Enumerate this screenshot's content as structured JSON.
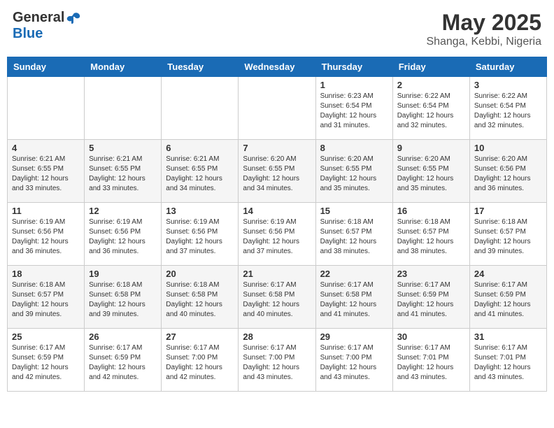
{
  "header": {
    "logo_general": "General",
    "logo_blue": "Blue",
    "title": "May 2025",
    "subtitle": "Shanga, Kebbi, Nigeria"
  },
  "days_of_week": [
    "Sunday",
    "Monday",
    "Tuesday",
    "Wednesday",
    "Thursday",
    "Friday",
    "Saturday"
  ],
  "weeks": [
    [
      {
        "day": "",
        "info": ""
      },
      {
        "day": "",
        "info": ""
      },
      {
        "day": "",
        "info": ""
      },
      {
        "day": "",
        "info": ""
      },
      {
        "day": "1",
        "info": "Sunrise: 6:23 AM\nSunset: 6:54 PM\nDaylight: 12 hours\nand 31 minutes."
      },
      {
        "day": "2",
        "info": "Sunrise: 6:22 AM\nSunset: 6:54 PM\nDaylight: 12 hours\nand 32 minutes."
      },
      {
        "day": "3",
        "info": "Sunrise: 6:22 AM\nSunset: 6:54 PM\nDaylight: 12 hours\nand 32 minutes."
      }
    ],
    [
      {
        "day": "4",
        "info": "Sunrise: 6:21 AM\nSunset: 6:55 PM\nDaylight: 12 hours\nand 33 minutes."
      },
      {
        "day": "5",
        "info": "Sunrise: 6:21 AM\nSunset: 6:55 PM\nDaylight: 12 hours\nand 33 minutes."
      },
      {
        "day": "6",
        "info": "Sunrise: 6:21 AM\nSunset: 6:55 PM\nDaylight: 12 hours\nand 34 minutes."
      },
      {
        "day": "7",
        "info": "Sunrise: 6:20 AM\nSunset: 6:55 PM\nDaylight: 12 hours\nand 34 minutes."
      },
      {
        "day": "8",
        "info": "Sunrise: 6:20 AM\nSunset: 6:55 PM\nDaylight: 12 hours\nand 35 minutes."
      },
      {
        "day": "9",
        "info": "Sunrise: 6:20 AM\nSunset: 6:55 PM\nDaylight: 12 hours\nand 35 minutes."
      },
      {
        "day": "10",
        "info": "Sunrise: 6:20 AM\nSunset: 6:56 PM\nDaylight: 12 hours\nand 36 minutes."
      }
    ],
    [
      {
        "day": "11",
        "info": "Sunrise: 6:19 AM\nSunset: 6:56 PM\nDaylight: 12 hours\nand 36 minutes."
      },
      {
        "day": "12",
        "info": "Sunrise: 6:19 AM\nSunset: 6:56 PM\nDaylight: 12 hours\nand 36 minutes."
      },
      {
        "day": "13",
        "info": "Sunrise: 6:19 AM\nSunset: 6:56 PM\nDaylight: 12 hours\nand 37 minutes."
      },
      {
        "day": "14",
        "info": "Sunrise: 6:19 AM\nSunset: 6:56 PM\nDaylight: 12 hours\nand 37 minutes."
      },
      {
        "day": "15",
        "info": "Sunrise: 6:18 AM\nSunset: 6:57 PM\nDaylight: 12 hours\nand 38 minutes."
      },
      {
        "day": "16",
        "info": "Sunrise: 6:18 AM\nSunset: 6:57 PM\nDaylight: 12 hours\nand 38 minutes."
      },
      {
        "day": "17",
        "info": "Sunrise: 6:18 AM\nSunset: 6:57 PM\nDaylight: 12 hours\nand 39 minutes."
      }
    ],
    [
      {
        "day": "18",
        "info": "Sunrise: 6:18 AM\nSunset: 6:57 PM\nDaylight: 12 hours\nand 39 minutes."
      },
      {
        "day": "19",
        "info": "Sunrise: 6:18 AM\nSunset: 6:58 PM\nDaylight: 12 hours\nand 39 minutes."
      },
      {
        "day": "20",
        "info": "Sunrise: 6:18 AM\nSunset: 6:58 PM\nDaylight: 12 hours\nand 40 minutes."
      },
      {
        "day": "21",
        "info": "Sunrise: 6:17 AM\nSunset: 6:58 PM\nDaylight: 12 hours\nand 40 minutes."
      },
      {
        "day": "22",
        "info": "Sunrise: 6:17 AM\nSunset: 6:58 PM\nDaylight: 12 hours\nand 41 minutes."
      },
      {
        "day": "23",
        "info": "Sunrise: 6:17 AM\nSunset: 6:59 PM\nDaylight: 12 hours\nand 41 minutes."
      },
      {
        "day": "24",
        "info": "Sunrise: 6:17 AM\nSunset: 6:59 PM\nDaylight: 12 hours\nand 41 minutes."
      }
    ],
    [
      {
        "day": "25",
        "info": "Sunrise: 6:17 AM\nSunset: 6:59 PM\nDaylight: 12 hours\nand 42 minutes."
      },
      {
        "day": "26",
        "info": "Sunrise: 6:17 AM\nSunset: 6:59 PM\nDaylight: 12 hours\nand 42 minutes."
      },
      {
        "day": "27",
        "info": "Sunrise: 6:17 AM\nSunset: 7:00 PM\nDaylight: 12 hours\nand 42 minutes."
      },
      {
        "day": "28",
        "info": "Sunrise: 6:17 AM\nSunset: 7:00 PM\nDaylight: 12 hours\nand 43 minutes."
      },
      {
        "day": "29",
        "info": "Sunrise: 6:17 AM\nSunset: 7:00 PM\nDaylight: 12 hours\nand 43 minutes."
      },
      {
        "day": "30",
        "info": "Sunrise: 6:17 AM\nSunset: 7:01 PM\nDaylight: 12 hours\nand 43 minutes."
      },
      {
        "day": "31",
        "info": "Sunrise: 6:17 AM\nSunset: 7:01 PM\nDaylight: 12 hours\nand 43 minutes."
      }
    ]
  ]
}
